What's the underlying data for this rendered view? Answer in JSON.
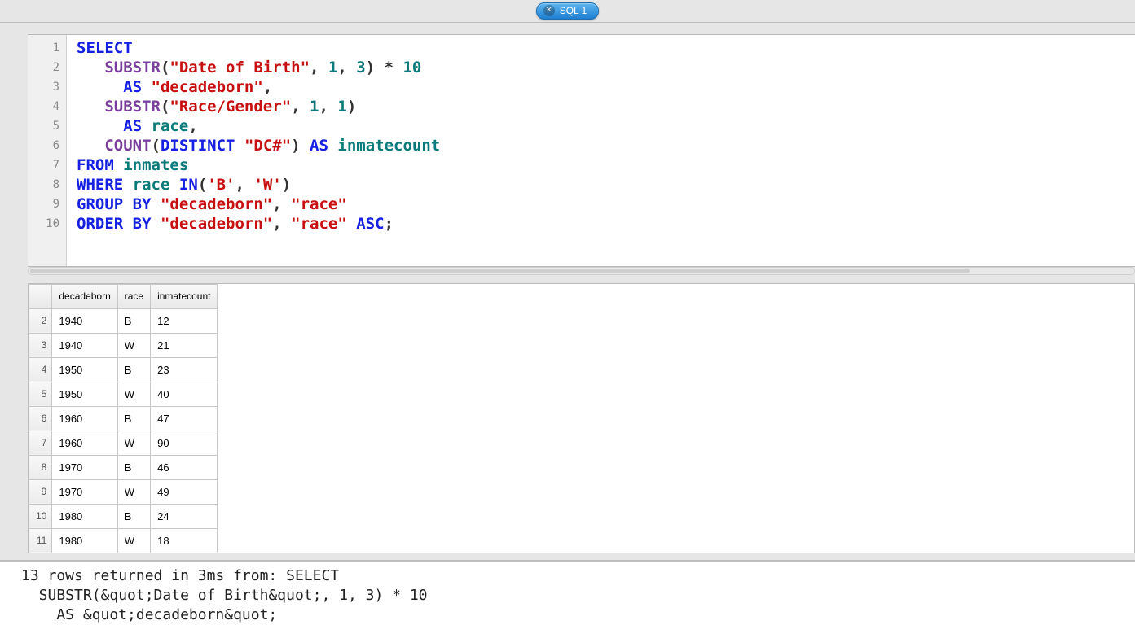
{
  "tab": {
    "label": "SQL 1"
  },
  "editor": {
    "line_numbers": [
      "1",
      "2",
      "3",
      "4",
      "5",
      "6",
      "7",
      "8",
      "9",
      "10"
    ],
    "code_tokens": [
      [
        [
          "kw",
          "SELECT"
        ]
      ],
      [
        [
          "",
          "   "
        ],
        [
          "fn",
          "SUBSTR"
        ],
        [
          "punc",
          "("
        ],
        [
          "str",
          "\"Date of Birth\""
        ],
        [
          "punc",
          ", "
        ],
        [
          "num",
          "1"
        ],
        [
          "punc",
          ", "
        ],
        [
          "num",
          "3"
        ],
        [
          "punc",
          ") * "
        ],
        [
          "num",
          "10"
        ]
      ],
      [
        [
          "",
          "     "
        ],
        [
          "kw",
          "AS"
        ],
        [
          "",
          " "
        ],
        [
          "str",
          "\"decadeborn\""
        ],
        [
          "punc",
          ","
        ]
      ],
      [
        [
          "",
          "   "
        ],
        [
          "fn",
          "SUBSTR"
        ],
        [
          "punc",
          "("
        ],
        [
          "str",
          "\"Race/Gender\""
        ],
        [
          "punc",
          ", "
        ],
        [
          "num",
          "1"
        ],
        [
          "punc",
          ", "
        ],
        [
          "num",
          "1"
        ],
        [
          "punc",
          ")"
        ]
      ],
      [
        [
          "",
          "     "
        ],
        [
          "kw",
          "AS"
        ],
        [
          "",
          " "
        ],
        [
          "id",
          "race"
        ],
        [
          "punc",
          ","
        ]
      ],
      [
        [
          "",
          "   "
        ],
        [
          "fn",
          "COUNT"
        ],
        [
          "punc",
          "("
        ],
        [
          "kw",
          "DISTINCT"
        ],
        [
          "",
          " "
        ],
        [
          "str",
          "\"DC#\""
        ],
        [
          "punc",
          ") "
        ],
        [
          "kw",
          "AS"
        ],
        [
          "",
          " "
        ],
        [
          "id",
          "inmatecount"
        ]
      ],
      [
        [
          "kw",
          "FROM"
        ],
        [
          "",
          " "
        ],
        [
          "id",
          "inmates"
        ]
      ],
      [
        [
          "kw",
          "WHERE"
        ],
        [
          "",
          " "
        ],
        [
          "id",
          "race"
        ],
        [
          "",
          " "
        ],
        [
          "kw",
          "IN"
        ],
        [
          "punc",
          "("
        ],
        [
          "str",
          "'B'"
        ],
        [
          "punc",
          ", "
        ],
        [
          "str",
          "'W'"
        ],
        [
          "punc",
          ")"
        ]
      ],
      [
        [
          "kw",
          "GROUP BY"
        ],
        [
          "",
          " "
        ],
        [
          "str",
          "\"decadeborn\""
        ],
        [
          "punc",
          ", "
        ],
        [
          "str",
          "\"race\""
        ]
      ],
      [
        [
          "kw",
          "ORDER BY"
        ],
        [
          "",
          " "
        ],
        [
          "str",
          "\"decadeborn\""
        ],
        [
          "punc",
          ", "
        ],
        [
          "str",
          "\"race\""
        ],
        [
          "",
          " "
        ],
        [
          "kw",
          "ASC"
        ],
        [
          "punc",
          ";"
        ]
      ]
    ]
  },
  "results": {
    "columns": [
      "decadeborn",
      "race",
      "inmatecount"
    ],
    "row_start": 2,
    "rows": [
      [
        "1940",
        "B",
        "12"
      ],
      [
        "1940",
        "W",
        "21"
      ],
      [
        "1950",
        "B",
        "23"
      ],
      [
        "1950",
        "W",
        "40"
      ],
      [
        "1960",
        "B",
        "47"
      ],
      [
        "1960",
        "W",
        "90"
      ],
      [
        "1970",
        "B",
        "46"
      ],
      [
        "1970",
        "W",
        "49"
      ],
      [
        "1980",
        "B",
        "24"
      ],
      [
        "1980",
        "W",
        "18"
      ]
    ]
  },
  "status": {
    "lines": [
      "13 rows returned in 3ms from: SELECT",
      "  SUBSTR(&quot;Date of Birth&quot;, 1, 3) * 10",
      "    AS &quot;decadeborn&quot;"
    ]
  }
}
